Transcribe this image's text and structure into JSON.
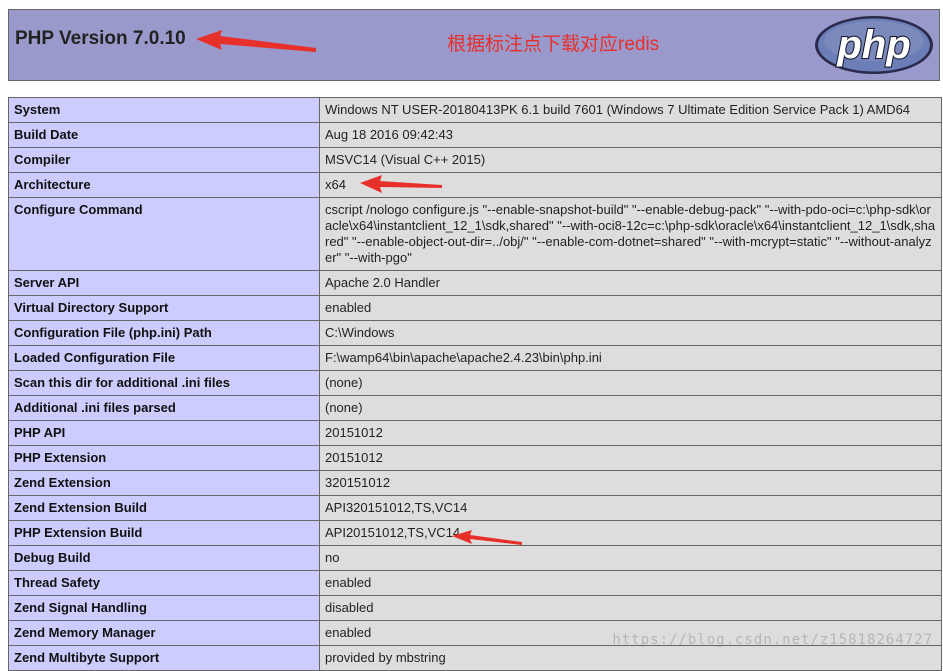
{
  "header": {
    "title": "PHP Version 7.0.10",
    "annotation": "根据标注点下载对应redis",
    "logo_text": "php"
  },
  "rows": [
    {
      "label": "System",
      "value": "Windows NT USER-20180413PK 6.1 build 7601 (Windows 7 Ultimate Edition Service Pack 1) AMD64"
    },
    {
      "label": "Build Date",
      "value": "Aug 18 2016 09:42:43"
    },
    {
      "label": "Compiler",
      "value": "MSVC14 (Visual C++ 2015)"
    },
    {
      "label": "Architecture",
      "value": "x64"
    },
    {
      "label": "Configure Command",
      "value": "cscript /nologo configure.js \"--enable-snapshot-build\" \"--enable-debug-pack\" \"--with-pdo-oci=c:\\php-sdk\\oracle\\x64\\instantclient_12_1\\sdk,shared\" \"--with-oci8-12c=c:\\php-sdk\\oracle\\x64\\instantclient_12_1\\sdk,shared\" \"--enable-object-out-dir=../obj/\" \"--enable-com-dotnet=shared\" \"--with-mcrypt=static\" \"--without-analyzer\" \"--with-pgo\""
    },
    {
      "label": "Server API",
      "value": "Apache 2.0 Handler"
    },
    {
      "label": "Virtual Directory Support",
      "value": "enabled"
    },
    {
      "label": "Configuration File (php.ini) Path",
      "value": "C:\\Windows"
    },
    {
      "label": "Loaded Configuration File",
      "value": "F:\\wamp64\\bin\\apache\\apache2.4.23\\bin\\php.ini"
    },
    {
      "label": "Scan this dir for additional .ini files",
      "value": "(none)"
    },
    {
      "label": "Additional .ini files parsed",
      "value": "(none)"
    },
    {
      "label": "PHP API",
      "value": "20151012"
    },
    {
      "label": "PHP Extension",
      "value": "20151012"
    },
    {
      "label": "Zend Extension",
      "value": "320151012"
    },
    {
      "label": "Zend Extension Build",
      "value": "API320151012,TS,VC14"
    },
    {
      "label": "PHP Extension Build",
      "value": "API20151012,TS,VC14"
    },
    {
      "label": "Debug Build",
      "value": "no"
    },
    {
      "label": "Thread Safety",
      "value": "enabled"
    },
    {
      "label": "Zend Signal Handling",
      "value": "disabled"
    },
    {
      "label": "Zend Memory Manager",
      "value": "enabled"
    },
    {
      "label": "Zend Multibyte Support",
      "value": "provided by mbstring"
    }
  ],
  "watermark": "https://blog.csdn.net/z15818264727",
  "colors": {
    "header_bg": "#9999cc",
    "label_bg": "#ccccff",
    "value_bg": "#dddddd",
    "annotation": "#e8302a",
    "logo_bg": "#6c7eb7"
  }
}
